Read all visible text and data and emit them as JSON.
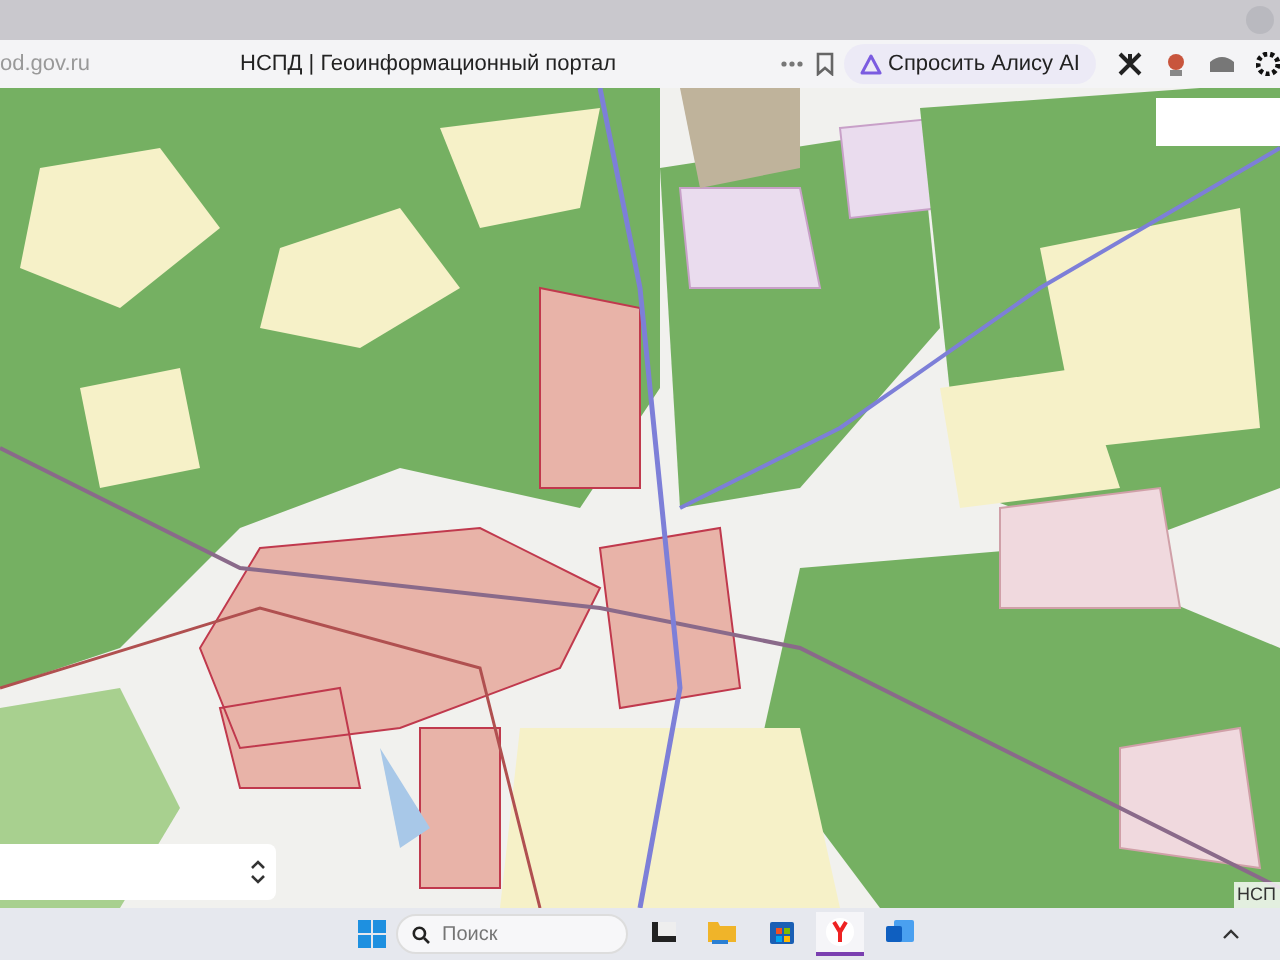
{
  "browser": {
    "url": "od.gov.ru",
    "title": "НСПД | Геоинформационный портал",
    "ask_button": "Спросить Алису AI"
  },
  "map": {
    "attribution": "НСП"
  },
  "taskbar": {
    "search_placeholder": "Поиск",
    "apps": [
      {
        "kind": "window",
        "selected": false
      },
      {
        "kind": "folder",
        "selected": false
      },
      {
        "kind": "store",
        "selected": false
      },
      {
        "kind": "browser",
        "selected": true
      },
      {
        "kind": "mail",
        "selected": false
      }
    ]
  }
}
